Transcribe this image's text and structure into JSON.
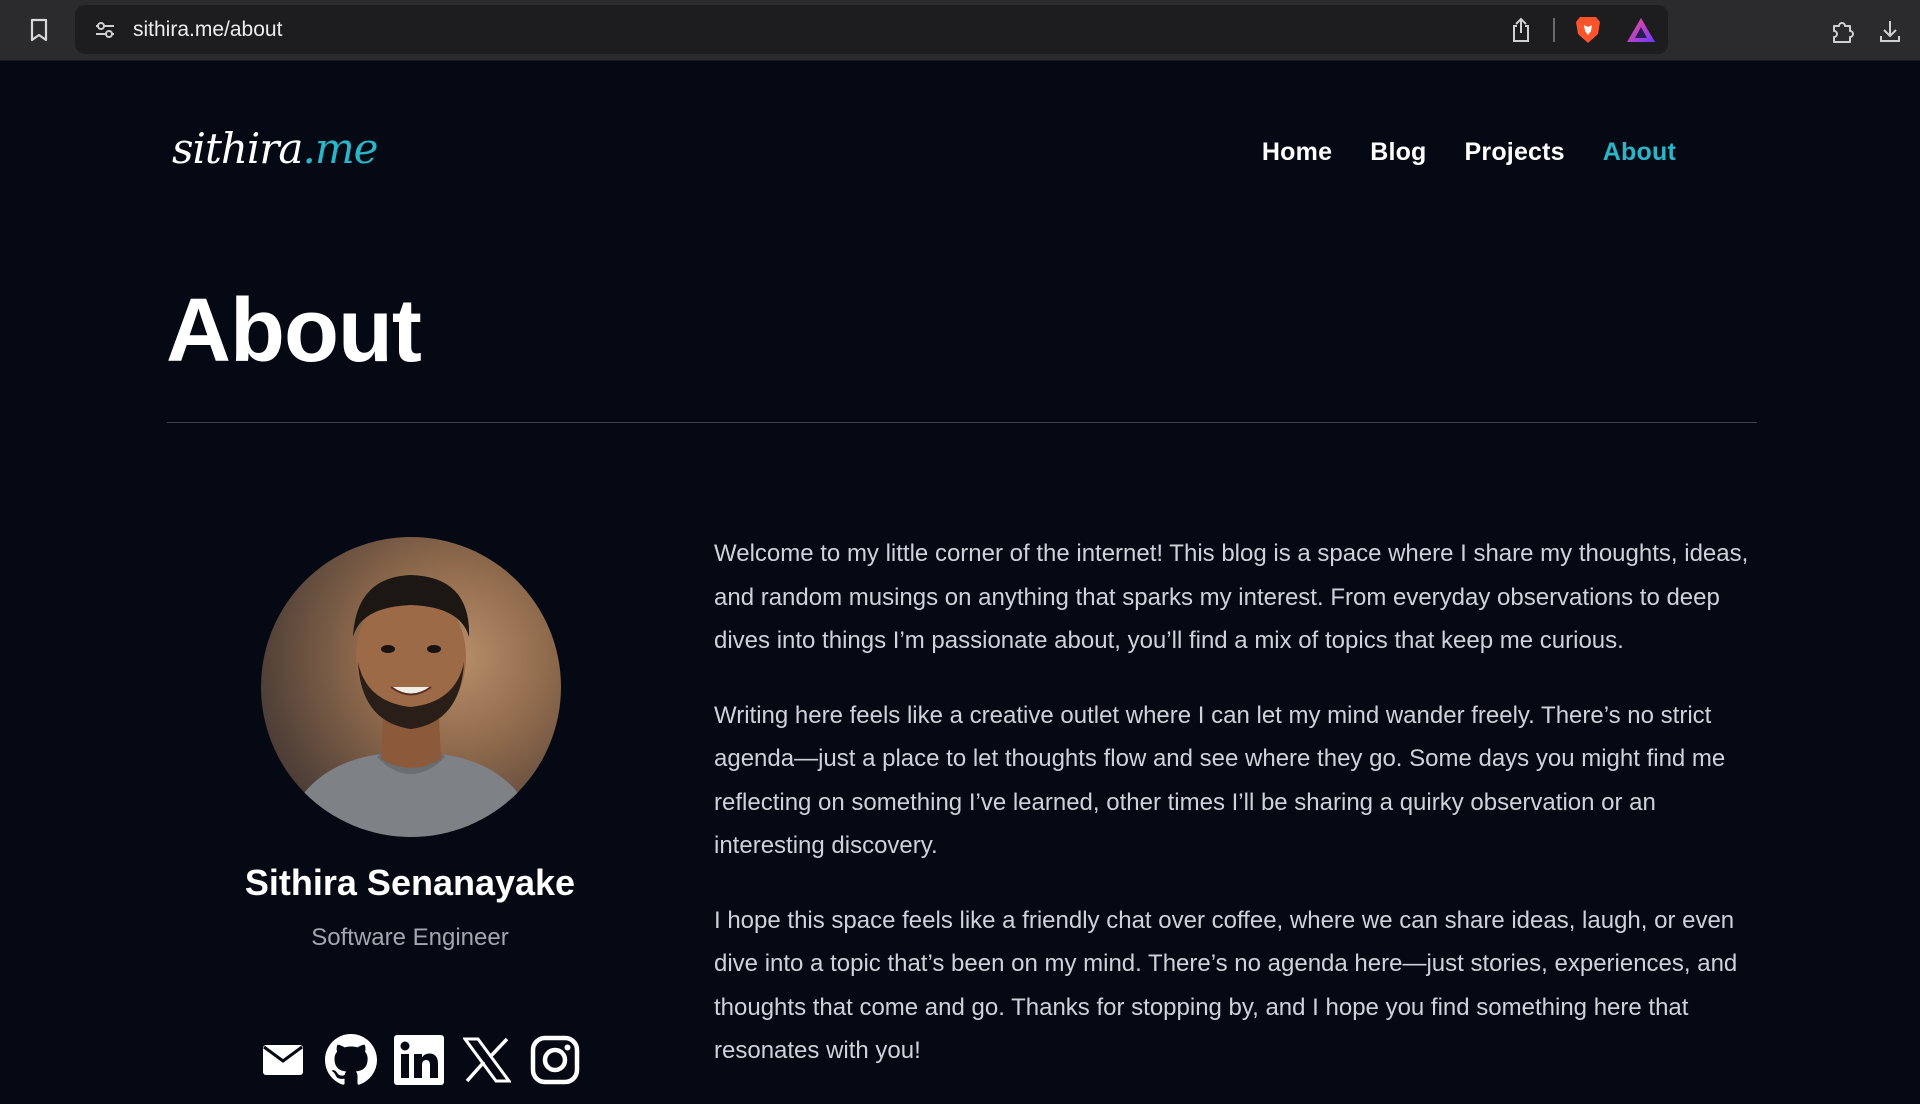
{
  "browser": {
    "url": "sithira.me/about"
  },
  "site": {
    "logo_part1": "sithira",
    "logo_part2": ".me",
    "accent_color": "#2bb5c9",
    "nav": [
      {
        "label": "Home",
        "active": false
      },
      {
        "label": "Blog",
        "active": false
      },
      {
        "label": "Projects",
        "active": false
      },
      {
        "label": "About",
        "active": true
      }
    ]
  },
  "page": {
    "title": "About",
    "profile": {
      "name": "Sithira Senanayake",
      "role": "Software Engineer",
      "socials": [
        "mail-icon",
        "github-icon",
        "linkedin-icon",
        "x-icon",
        "instagram-icon"
      ]
    },
    "bio": [
      "Welcome to my little corner of the internet! This blog is a space where I share my thoughts, ideas, and random musings on anything that sparks my interest. From everyday observations to deep dives into things I’m passionate about, you’ll find a mix of topics that keep me curious.",
      "Writing here feels like a creative outlet where I can let my mind wander freely. There’s no strict agenda—just a place to let thoughts flow and see where they go. Some days you might find me reflecting on something I’ve learned, other times I’ll be sharing a quirky observation or an interesting discovery.",
      "I hope this space feels like a friendly chat over coffee, where we can share ideas, laugh, or even dive into a topic that’s been on my mind. There’s no agenda here—just stories, experiences, and thoughts that come and go. Thanks for stopping by, and I hope you find something here that resonates with you!"
    ]
  }
}
